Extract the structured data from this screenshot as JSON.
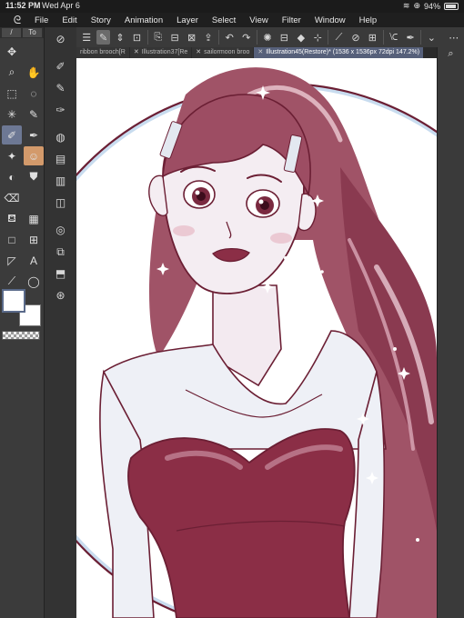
{
  "status": {
    "time": "11:52 PM",
    "date": "Wed Apr 6",
    "battery": "94%"
  },
  "menu": [
    "File",
    "Edit",
    "Story",
    "Animation",
    "Layer",
    "Select",
    "View",
    "Filter",
    "Window",
    "Help"
  ],
  "toolbar_header": {
    "left": "/",
    "right": "To"
  },
  "tabs": [
    {
      "label": "ribbon brooch[R",
      "active": false
    },
    {
      "label": "Illustration37[Re",
      "active": false
    },
    {
      "label": "sailormoon broo",
      "active": false
    },
    {
      "label": "Illustration45(Restore)* (1536 x 1536px 72dpi 147.2%)",
      "active": true
    }
  ],
  "colors": {
    "foreground": "#ffffff",
    "background": "#ffffff",
    "line_art": "#6b1f34",
    "shadow": "#b8cfe6"
  }
}
